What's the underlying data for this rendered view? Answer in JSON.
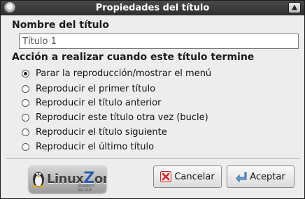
{
  "window": {
    "title": "Propiedades del título"
  },
  "name_section": {
    "label": "Nombre del título",
    "value": "Título 1"
  },
  "action_section": {
    "label": "Acción a realizar cuando este título termine",
    "options": [
      {
        "label": "Parar la reproducción/mostrar el menú",
        "checked": true
      },
      {
        "label": "Reproducir el primer título",
        "checked": false
      },
      {
        "label": "Reproducir el título anterior",
        "checked": false
      },
      {
        "label": "Reproducir este título otra vez (bucle)",
        "checked": false
      },
      {
        "label": "Reproducir el título siguiente",
        "checked": false
      },
      {
        "label": "Reproducir el último título",
        "checked": false
      }
    ]
  },
  "logo": {
    "text": "LinuxZone",
    "subtext": "JOHNER'S ARCADE"
  },
  "buttons": {
    "cancel": "Cancelar",
    "accept": "Aceptar"
  },
  "colors": {
    "titlebar": "#2e2e2e",
    "cancel_icon": "#c0272d",
    "accept_icon": "#3f7fc0"
  }
}
